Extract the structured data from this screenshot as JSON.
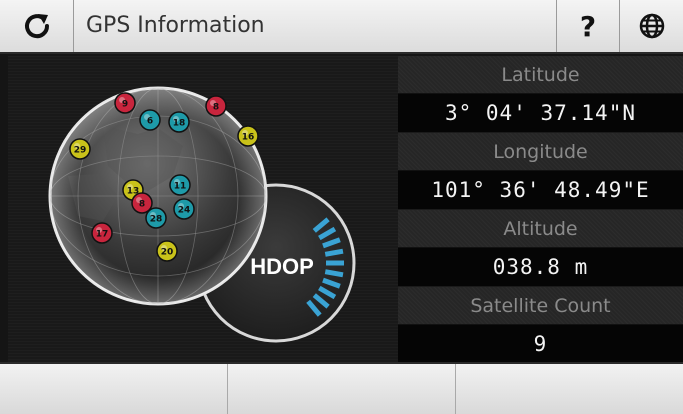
{
  "header": {
    "title": "GPS Information",
    "help_label": "?"
  },
  "hdop": {
    "label": "HDOP",
    "bars_lit": 10,
    "accent_color": "#3aa3d4"
  },
  "info": [
    {
      "label": "Latitude",
      "value": "3° 04' 37.14\"N"
    },
    {
      "label": "Longitude",
      "value": "101° 36' 48.49\"E"
    },
    {
      "label": "Altitude",
      "value": "038.8 m"
    },
    {
      "label": "Satellite Count",
      "value": "9"
    }
  ],
  "satellites": [
    {
      "id": "9",
      "color": "red"
    },
    {
      "id": "6",
      "color": "teal"
    },
    {
      "id": "18",
      "color": "teal"
    },
    {
      "id": "8",
      "color": "red"
    },
    {
      "id": "29",
      "color": "yellow"
    },
    {
      "id": "16",
      "color": "yellow"
    },
    {
      "id": "13",
      "color": "yellow"
    },
    {
      "id": "11",
      "color": "teal"
    },
    {
      "id": "8",
      "color": "red"
    },
    {
      "id": "24",
      "color": "teal"
    },
    {
      "id": "28",
      "color": "teal"
    },
    {
      "id": "17",
      "color": "red"
    },
    {
      "id": "20",
      "color": "yellow"
    }
  ],
  "colors": {
    "red": "#c8253d",
    "teal": "#1e9aa8",
    "yellow": "#c9c21a"
  },
  "icons": [
    "refresh-icon",
    "help-icon",
    "globe-icon"
  ]
}
